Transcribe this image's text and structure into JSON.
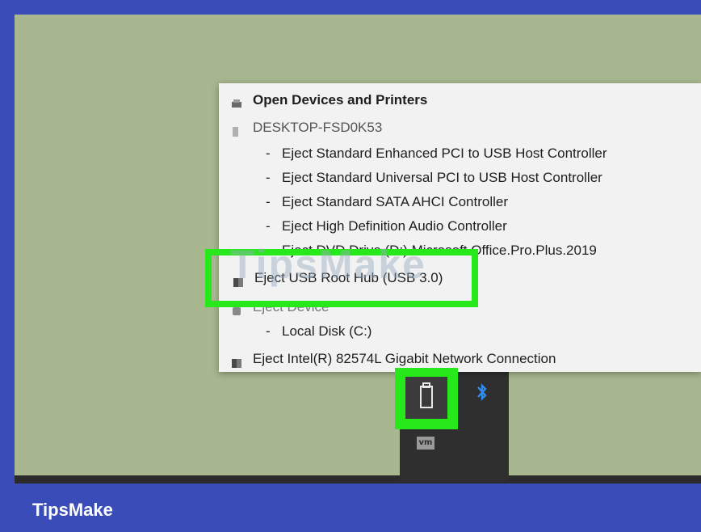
{
  "menu": {
    "open_devices": "Open Devices and Printers",
    "computer_name": "DESKTOP-FSD0K53",
    "eject_pci_enhanced": "Eject Standard Enhanced PCI to USB Host Controller",
    "eject_pci_universal": "Eject Standard Universal PCI to USB Host Controller",
    "eject_sata": "Eject Standard SATA AHCI Controller",
    "eject_audio": "Eject High Definition Audio Controller",
    "eject_dvd": "Eject DVD Drive (D:) Microsoft.Office.Pro.Plus.2019",
    "eject_usb_root_hub": "Eject USB Root Hub (USB 3.0)",
    "eject_device": "Eject Device",
    "local_disk": "Local Disk (C:)",
    "eject_network": "Eject Intel(R) 82574L Gigabit Network Connection",
    "dash": "-"
  },
  "watermark": "TipsMake",
  "tray": {
    "usb_icon": "usb-drive-icon",
    "bluetooth_icon": "bluetooth-icon",
    "vm_icon_label": "vm"
  },
  "footer": {
    "brand": "TipsMake"
  },
  "colors": {
    "highlight": "#27e81b",
    "desktop": "#a8b78f",
    "frame": "#3a4cb7"
  }
}
